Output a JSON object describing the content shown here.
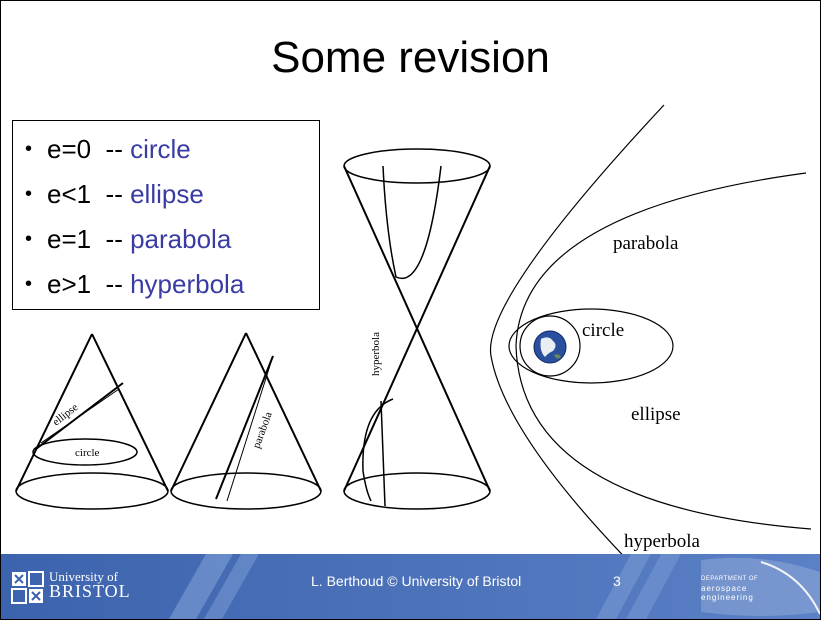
{
  "slide": {
    "title": "Some revision",
    "bullets": [
      {
        "bullet": "•",
        "prefix": "e=0  -- ",
        "term": "circle"
      },
      {
        "bullet": "•",
        "prefix": "e<1  -- ",
        "term": "ellipse"
      },
      {
        "bullet": "•",
        "prefix": "e=1  -- ",
        "term": "parabola"
      },
      {
        "bullet": "•",
        "prefix": "e>1  -- ",
        "term": "hyperbola"
      }
    ],
    "cone_labels": {
      "ellipse": "ellipse",
      "circle": "circle",
      "parabola": "parabola",
      "hyperbola": "hyperbola"
    },
    "orbit_labels": {
      "parabola": "parabola",
      "circle": "circle",
      "ellipse": "ellipse",
      "hyperbola": "hyperbola"
    }
  },
  "footer": {
    "university_line1": "University of",
    "university_line2": "BRISTOL",
    "credit": "L. Berthoud © University of Bristol",
    "page_number": "3",
    "department_line1": "DEPARTMENT OF",
    "department_line2": "aerospace",
    "department_line3": "engineering"
  },
  "colors": {
    "term_text": "#3a3ca4",
    "footer_blue": "#3f68b0",
    "footer_light": "#7e9fd6"
  }
}
